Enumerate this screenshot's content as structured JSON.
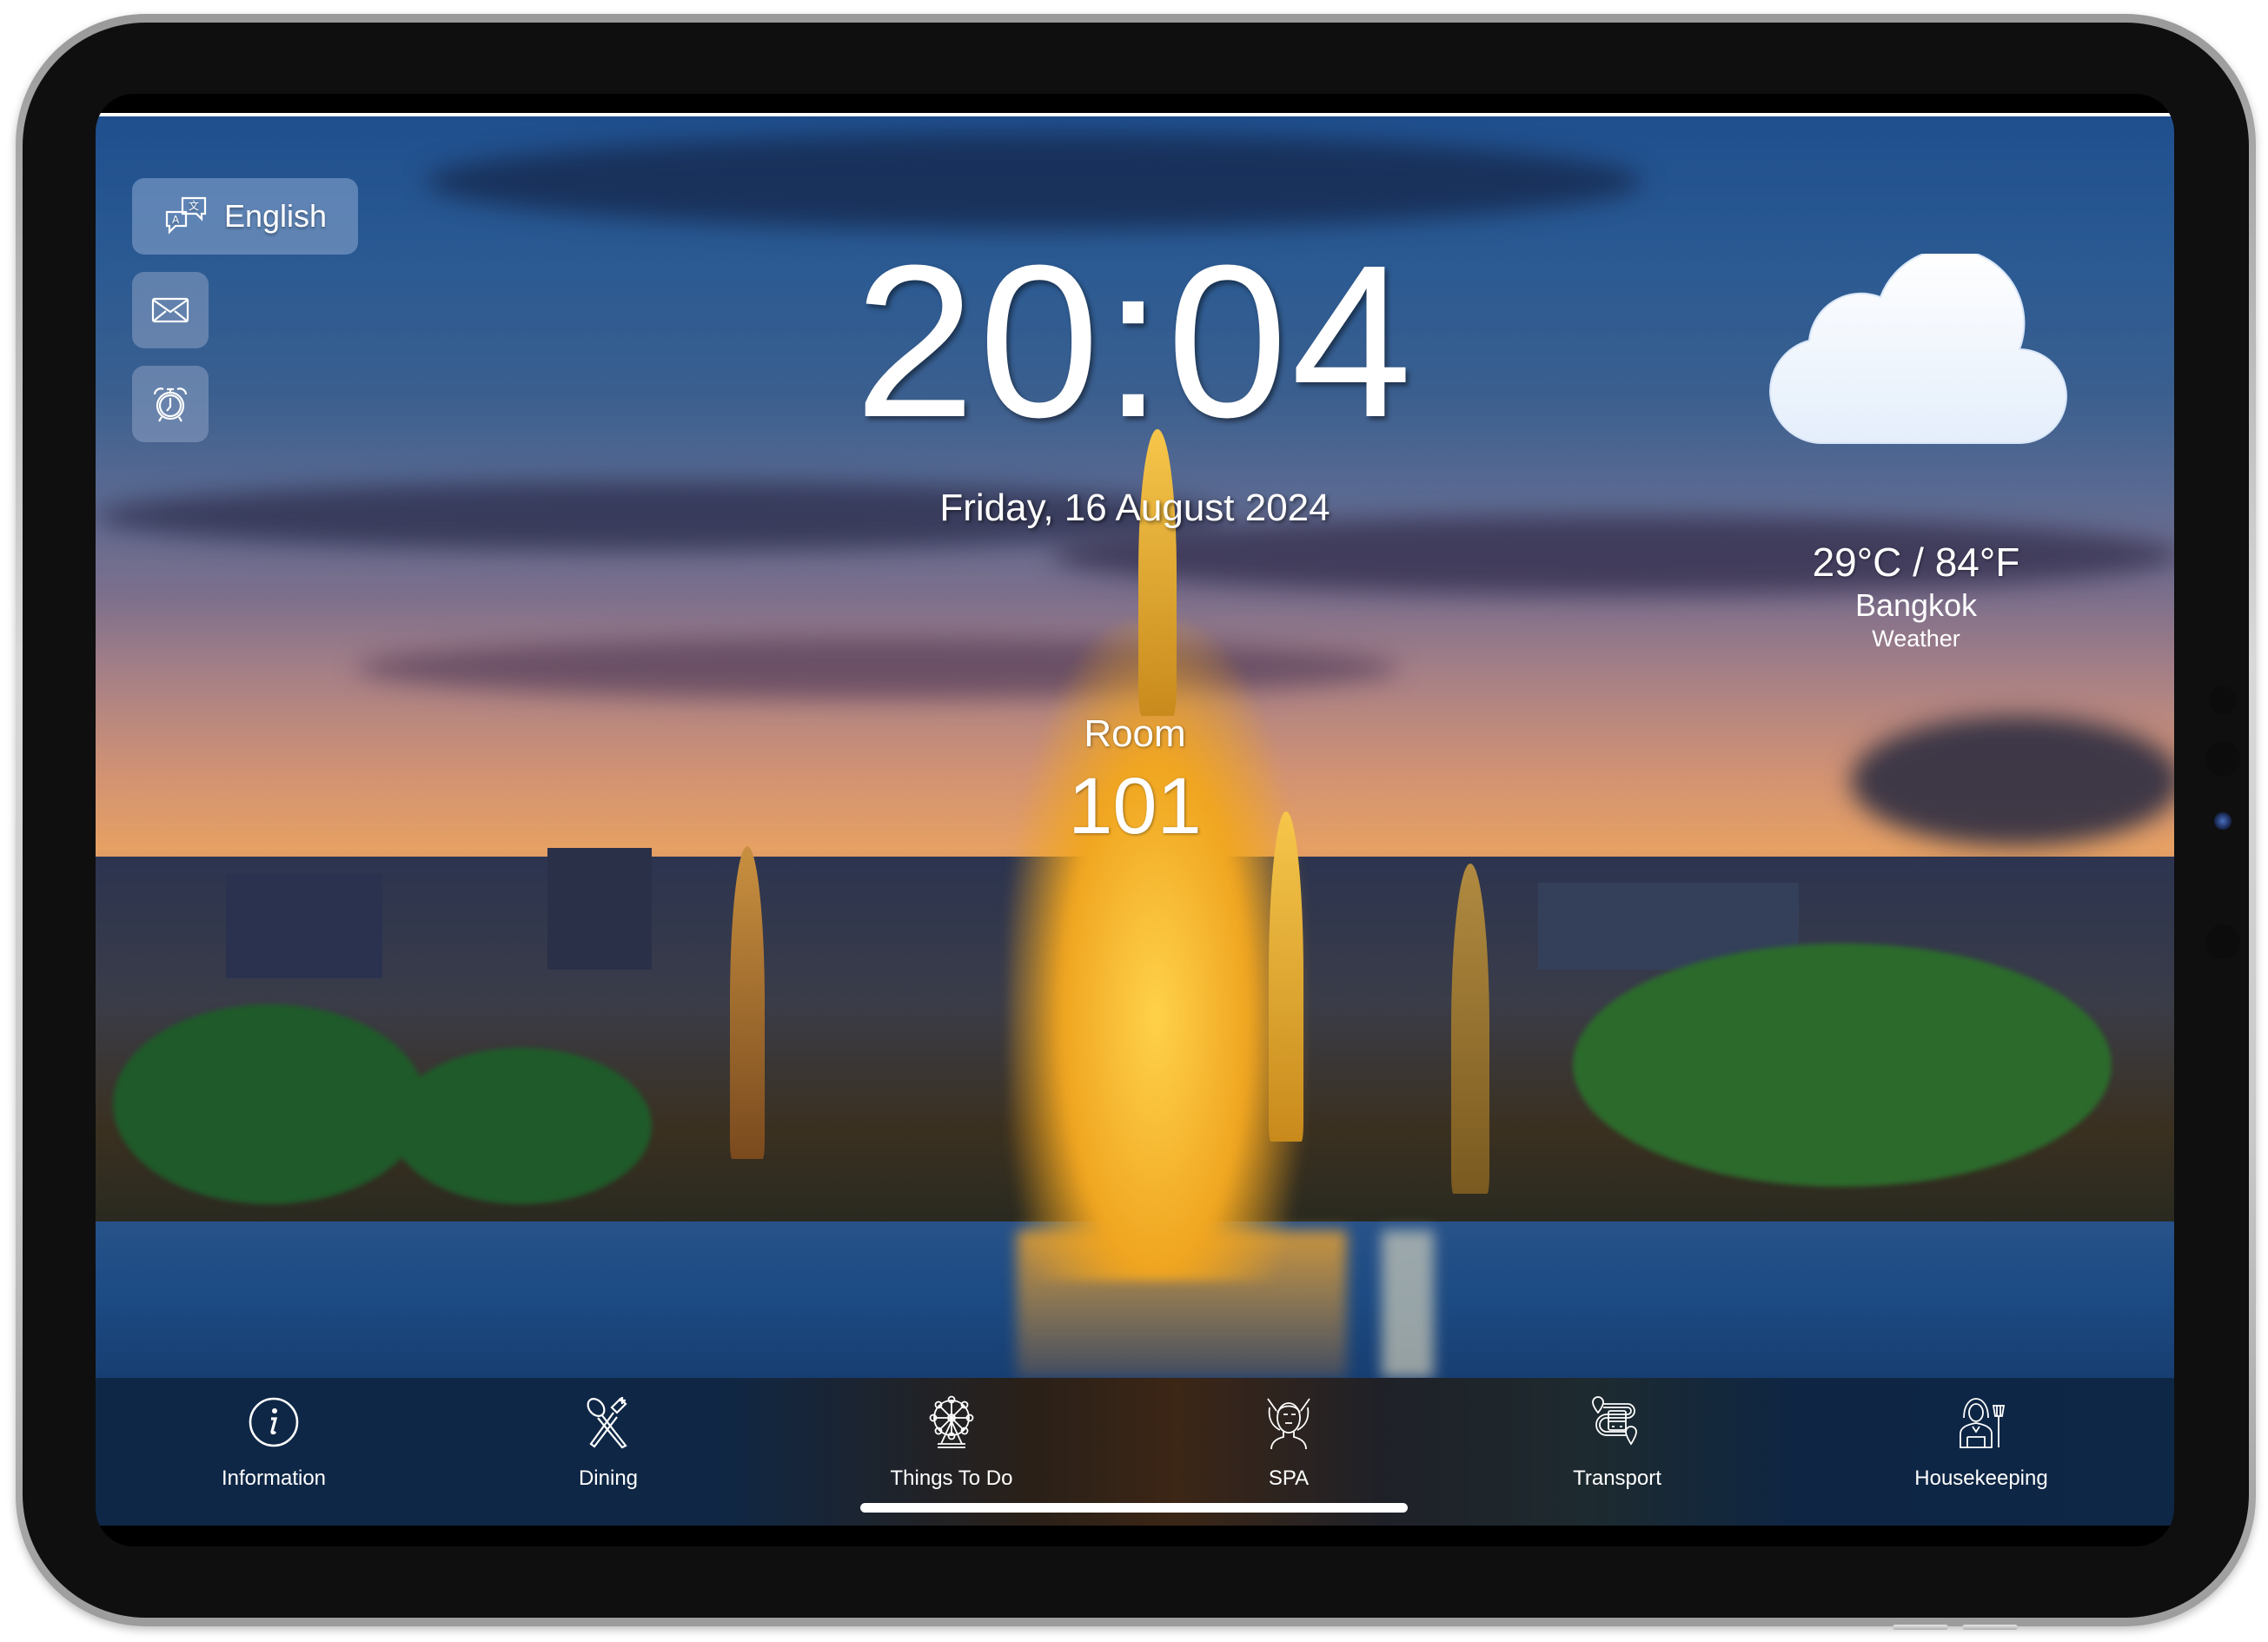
{
  "device": {
    "type": "tablet-frame"
  },
  "controls": {
    "language_button": {
      "label": "English",
      "icon": "translate-icon"
    },
    "message_button": {
      "icon": "envelope-icon"
    },
    "alarm_button": {
      "icon": "alarm-clock-icon"
    }
  },
  "clock": {
    "time": "20:04",
    "date": "Friday, 16 August 2024"
  },
  "room": {
    "label": "Room",
    "number": "101"
  },
  "weather": {
    "icon": "cloud-icon",
    "temperature": "29°C / 84°F",
    "city": "Bangkok",
    "label": "Weather"
  },
  "nav": {
    "items": [
      {
        "label": "Information",
        "icon": "info-icon"
      },
      {
        "label": "Dining",
        "icon": "spoon-fork-icon"
      },
      {
        "label": "Things To Do",
        "icon": "ferris-wheel-icon"
      },
      {
        "label": "SPA",
        "icon": "face-massage-icon"
      },
      {
        "label": "Transport",
        "icon": "bus-route-icon"
      },
      {
        "label": "Housekeeping",
        "icon": "housekeeper-icon"
      }
    ]
  },
  "colors": {
    "nav_bar": "#0f2747",
    "button_overlay": "#8caad2",
    "text": "#ffffff"
  }
}
